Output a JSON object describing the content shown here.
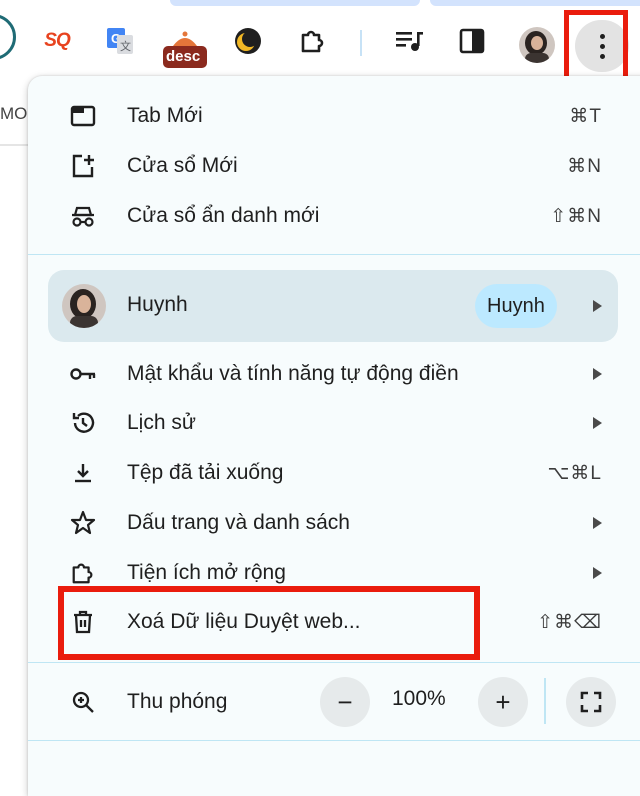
{
  "toolbar": {
    "sq_label": "SQ",
    "desc_label": "desc",
    "page_edge_text": "MO"
  },
  "menu": {
    "new_tab": {
      "label": "Tab Mới",
      "shortcut": "⌘T"
    },
    "new_window": {
      "label": "Cửa sổ Mới",
      "shortcut": "⌘N"
    },
    "incognito": {
      "label": "Cửa sổ ẩn danh mới",
      "shortcut": "⇧⌘N"
    },
    "profile": {
      "name": "Huynh",
      "chip": "Huynh"
    },
    "passwords": {
      "label": "Mật khẩu và tính năng tự động điền"
    },
    "history": {
      "label": "Lịch sử"
    },
    "downloads": {
      "label": "Tệp đã tải xuống",
      "shortcut": "⌥⌘L"
    },
    "bookmarks": {
      "label": "Dấu trang và danh sách"
    },
    "extensions": {
      "label": "Tiện ích mở rộng"
    },
    "clear_data": {
      "label": "Xoá Dữ liệu Duyệt web...",
      "shortcut": "⇧⌘⌫"
    },
    "zoom": {
      "label": "Thu phóng",
      "minus": "−",
      "value": "100%",
      "plus": "+"
    }
  },
  "colors": {
    "highlight": "#ea1c0d",
    "menu_bg": "#f7fcfd",
    "chip_bg": "#bce9ff"
  }
}
